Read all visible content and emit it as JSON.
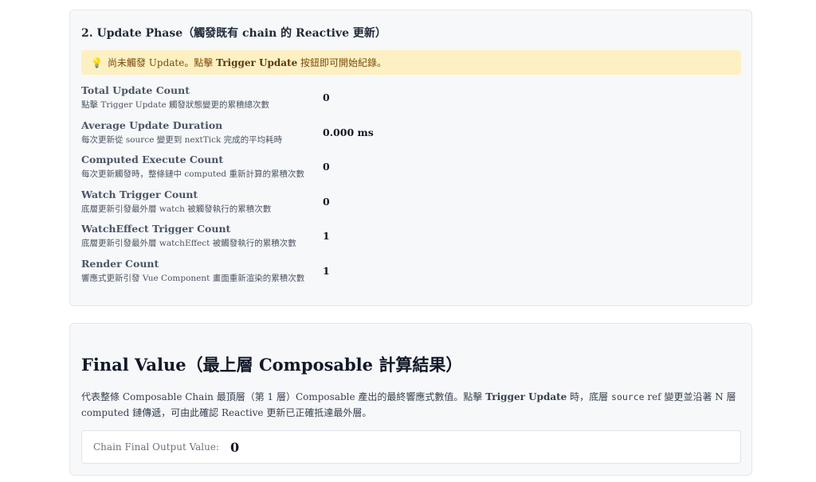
{
  "update_phase": {
    "title": "2. Update Phase（觸發既有 chain 的 Reactive 更新）",
    "notice": {
      "icon": "lightbulb-icon",
      "text_before": "尚未觸發 Update。點擊",
      "button_ref": "Trigger Update",
      "text_after": "按鈕即可開始紀錄。"
    },
    "metrics": [
      {
        "name": "Total Update Count",
        "desc": "點擊 Trigger Update 觸發狀態變更的累積總次數",
        "value": "0"
      },
      {
        "name": "Average Update Duration",
        "desc": "每次更新從 source 變更到 nextTick 完成的平均耗時",
        "value": "0.000 ms"
      },
      {
        "name": "Computed Execute Count",
        "desc": "每次更新觸發時，整條鏈中 computed 重新計算的累積次數",
        "value": "0"
      },
      {
        "name": "Watch Trigger Count",
        "desc": "底層更新引發最外層 watch 被觸發執行的累積次數",
        "value": "0"
      },
      {
        "name": "WatchEffect Trigger Count",
        "desc": "底層更新引發最外層 watchEffect 被觸發執行的累積次數",
        "value": "1"
      },
      {
        "name": "Render Count",
        "desc": "響應式更新引發 Vue Component 畫面重新渲染的累積次數",
        "value": "1"
      }
    ]
  },
  "final_value": {
    "title": "Final Value（最上層 Composable 計算結果）",
    "desc_1": "代表整條 Composable Chain 最頂層（第 1 層）Composable 產出的最終響應式數值。點擊",
    "desc_bold": "Trigger Update",
    "desc_2": "時，底層",
    "desc_code": "source",
    "desc_3": "ref 變更並沿著 N 層 computed 鏈傳遞，可由此確認 Reactive 更新已正確抵達最外層。",
    "output_label": "Chain Final Output Value:",
    "output_value": "0"
  }
}
